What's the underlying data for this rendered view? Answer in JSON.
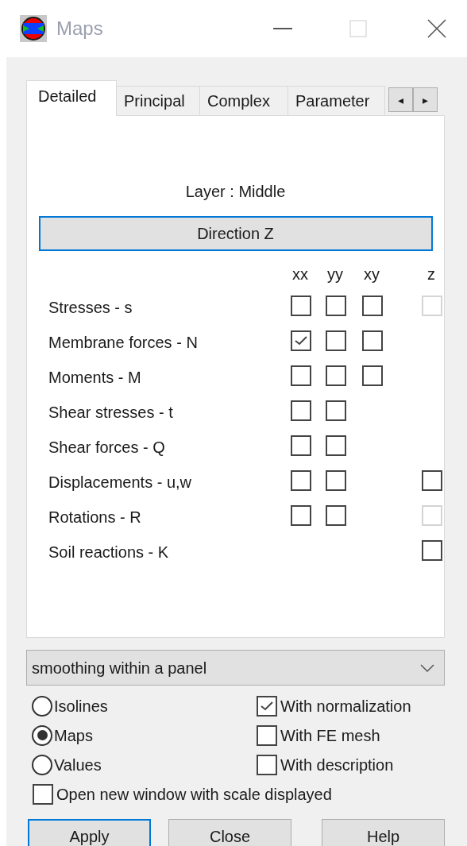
{
  "window": {
    "title": "Maps"
  },
  "tabs": [
    {
      "label": "Detailed",
      "selected": true
    },
    {
      "label": "Principal",
      "selected": false
    },
    {
      "label": "Complex",
      "selected": false
    },
    {
      "label": "Parameter",
      "selected": false
    }
  ],
  "tab_scroll": [
    "◂",
    "▸"
  ],
  "layer_label": "Layer : Middle",
  "direction_button": "Direction Z",
  "columns": [
    "xx",
    "yy",
    "xy",
    "z"
  ],
  "rows": [
    {
      "label": "Stresses - s",
      "boxes": {
        "xx": {
          "checked": false,
          "disabled": false
        },
        "yy": {
          "checked": false,
          "disabled": false
        },
        "xy": {
          "checked": false,
          "disabled": false
        },
        "z": {
          "checked": false,
          "disabled": true
        }
      }
    },
    {
      "label": "Membrane forces - N",
      "boxes": {
        "xx": {
          "checked": true,
          "disabled": false
        },
        "yy": {
          "checked": false,
          "disabled": false
        },
        "xy": {
          "checked": false,
          "disabled": false
        }
      }
    },
    {
      "label": "Moments - M",
      "boxes": {
        "xx": {
          "checked": false,
          "disabled": false
        },
        "yy": {
          "checked": false,
          "disabled": false
        },
        "xy": {
          "checked": false,
          "disabled": false
        }
      }
    },
    {
      "label": "Shear stresses - t",
      "boxes": {
        "xx": {
          "checked": false,
          "disabled": false
        },
        "yy": {
          "checked": false,
          "disabled": false
        }
      }
    },
    {
      "label": "Shear forces - Q",
      "boxes": {
        "xx": {
          "checked": false,
          "disabled": false
        },
        "yy": {
          "checked": false,
          "disabled": false
        }
      }
    },
    {
      "label": "Displacements - u,w",
      "boxes": {
        "xx": {
          "checked": false,
          "disabled": false
        },
        "yy": {
          "checked": false,
          "disabled": false
        },
        "z": {
          "checked": false,
          "disabled": false
        }
      }
    },
    {
      "label": "Rotations - R",
      "boxes": {
        "xx": {
          "checked": false,
          "disabled": false
        },
        "yy": {
          "checked": false,
          "disabled": false
        },
        "z": {
          "checked": false,
          "disabled": true
        }
      }
    },
    {
      "label": "Soil reactions - K",
      "boxes": {
        "z": {
          "checked": false,
          "disabled": false
        }
      }
    }
  ],
  "smoothing": {
    "value": "smoothing within a panel"
  },
  "display_modes": [
    {
      "label": "Isolines",
      "selected": false
    },
    {
      "label": "Maps",
      "selected": true
    },
    {
      "label": "Values",
      "selected": false
    }
  ],
  "options": [
    {
      "label": "With normalization",
      "checked": true
    },
    {
      "label": "With FE mesh",
      "checked": false
    },
    {
      "label": "With description",
      "checked": false
    }
  ],
  "open_new_window": {
    "label": "Open new window with scale displayed",
    "checked": false
  },
  "buttons": [
    {
      "label": "Apply",
      "default": true
    },
    {
      "label": "Close",
      "default": false
    },
    {
      "label": "Help",
      "default": false
    }
  ]
}
